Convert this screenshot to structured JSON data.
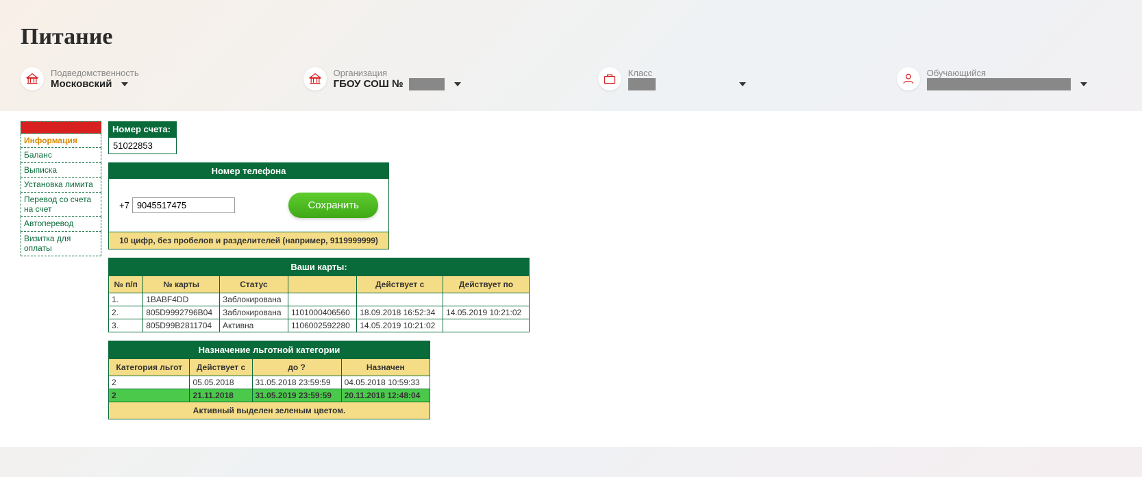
{
  "pageTitle": "Питание",
  "filters": {
    "jurisdiction": {
      "label": "Подведомственность",
      "value": "Московский"
    },
    "organization": {
      "label": "Организация",
      "value": "ГБОУ СОШ №"
    },
    "class": {
      "label": "Класс",
      "value": ""
    },
    "student": {
      "label": "Обучающийся",
      "value": ""
    }
  },
  "sidebar": {
    "items": [
      "Информация",
      "Баланс",
      "Выписка",
      "Установка лимита",
      "Перевод со счета на счет",
      "Автоперевод",
      "Визитка для оплаты"
    ],
    "activeIndex": 0
  },
  "account": {
    "label": "Номер счета:",
    "value": "51022853"
  },
  "phone": {
    "header": "Номер телефона",
    "prefix": "+7",
    "value": "9045517475",
    "saveLabel": "Сохранить",
    "hint": "10 цифр, без пробелов и разделителей (например, 9119999999)"
  },
  "cards": {
    "title": "Ваши карты:",
    "headers": [
      "№ п/п",
      "№ карты",
      "Статус",
      "",
      "Действует с",
      "Действует по"
    ],
    "rows": [
      [
        "1.",
        "1BABF4DD",
        "Заблокирована",
        "",
        "",
        ""
      ],
      [
        "2.",
        "805D9992796B04",
        "Заблокирована",
        "1101000406560",
        "18.09.2018 16:52:34",
        "14.05.2019 10:21:02"
      ],
      [
        "3.",
        "805D99B2811704",
        "Активна",
        "1106002592280",
        "14.05.2019 10:21:02",
        ""
      ]
    ]
  },
  "category": {
    "title": "Назначение льготной категории",
    "headers": [
      "Категория льгот",
      "Действует с",
      "до ?",
      "Назначен"
    ],
    "rows": [
      {
        "cells": [
          "2",
          "05.05.2018",
          "31.05.2018 23:59:59",
          "04.05.2018 10:59:33"
        ],
        "active": false
      },
      {
        "cells": [
          "2",
          "21.11.2018",
          "31.05.2019 23:59:59",
          "20.11.2018 12:48:04"
        ],
        "active": true
      }
    ],
    "footer": "Активный выделен зеленым цветом."
  }
}
